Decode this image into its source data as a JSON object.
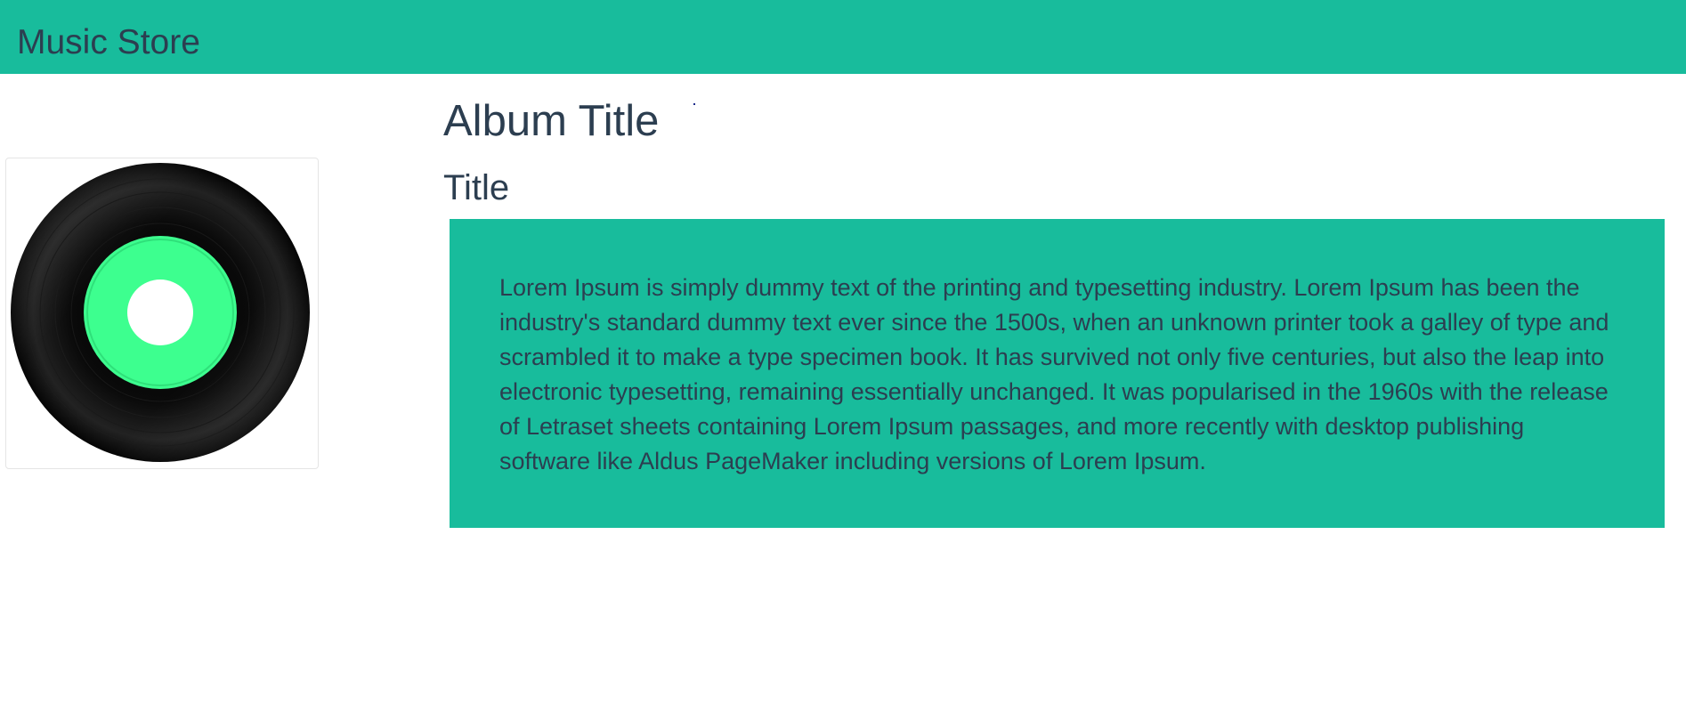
{
  "navbar": {
    "brand": "Music Store",
    "background_color": "#18bc9c"
  },
  "album": {
    "cover_icon": "vinyl-record-icon",
    "title": "Album Title",
    "track_title": "Title",
    "description": "Lorem Ipsum is simply dummy text of the printing and typesetting industry. Lorem Ipsum has been the industry's standard dummy text ever since the 1500s, when an unknown printer took a galley of type and scrambled it to make a type specimen book. It has survived not only five centuries, but also the leap into electronic typesetting, remaining essentially unchanged. It was popularised in the 1960s with the release of Letraset sheets containing Lorem Ipsum passages, and more recently with desktop publishing software like Aldus PageMaker including versions of Lorem Ipsum."
  },
  "colors": {
    "accent": "#18bc9c",
    "text": "#2c3e50",
    "record_label": "#3dff8f"
  }
}
